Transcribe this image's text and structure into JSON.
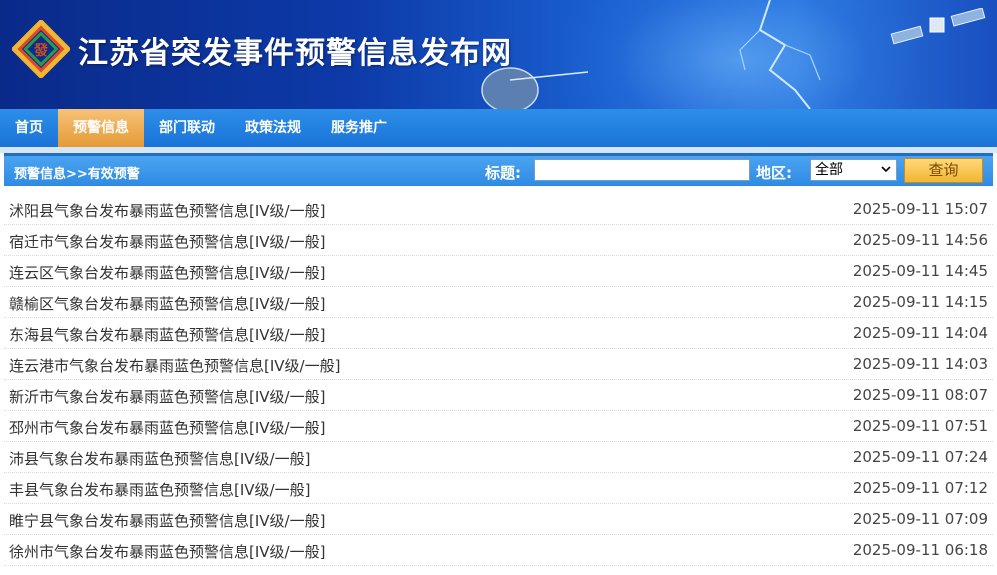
{
  "header": {
    "site_title": "江苏省突发事件预警信息发布网",
    "logo_char": "發"
  },
  "nav": {
    "items": [
      {
        "label": "首页",
        "active": false
      },
      {
        "label": "预警信息",
        "active": true
      },
      {
        "label": "部门联动",
        "active": false
      },
      {
        "label": "政策法规",
        "active": false
      },
      {
        "label": "服务推广",
        "active": false
      }
    ]
  },
  "search": {
    "breadcrumb": "预警信息>>有效预警",
    "title_label": "标题:",
    "title_value": "",
    "region_label": "地区:",
    "region_value": "全部",
    "query_label": "查询"
  },
  "alerts": [
    {
      "title": "沭阳县气象台发布暴雨蓝色预警信息[IV级/一般]",
      "time": "2025-09-11 15:07"
    },
    {
      "title": "宿迁市气象台发布暴雨蓝色预警信息[IV级/一般]",
      "time": "2025-09-11 14:56"
    },
    {
      "title": "连云区气象台发布暴雨蓝色预警信息[IV级/一般]",
      "time": "2025-09-11 14:45"
    },
    {
      "title": "赣榆区气象台发布暴雨蓝色预警信息[IV级/一般]",
      "time": "2025-09-11 14:15"
    },
    {
      "title": "东海县气象台发布暴雨蓝色预警信息[IV级/一般]",
      "time": "2025-09-11 14:04"
    },
    {
      "title": "连云港市气象台发布暴雨蓝色预警信息[IV级/一般]",
      "time": "2025-09-11 14:03"
    },
    {
      "title": "新沂市气象台发布暴雨蓝色预警信息[IV级/一般]",
      "time": "2025-09-11 08:07"
    },
    {
      "title": "邳州市气象台发布暴雨蓝色预警信息[IV级/一般]",
      "time": "2025-09-11 07:51"
    },
    {
      "title": "沛县气象台发布暴雨蓝色预警信息[IV级/一般]",
      "time": "2025-09-11 07:24"
    },
    {
      "title": "丰县气象台发布暴雨蓝色预警信息[IV级/一般]",
      "time": "2025-09-11 07:12"
    },
    {
      "title": "睢宁县气象台发布暴雨蓝色预警信息[IV级/一般]",
      "time": "2025-09-11 07:09"
    },
    {
      "title": "徐州市气象台发布暴雨蓝色预警信息[IV级/一般]",
      "time": "2025-09-11 06:18"
    }
  ],
  "colors": {
    "nav_bg": "#1a73d8",
    "nav_active": "#e59a35",
    "searchbar_bg": "#2f8ae4",
    "query_button": "#f2b632"
  }
}
